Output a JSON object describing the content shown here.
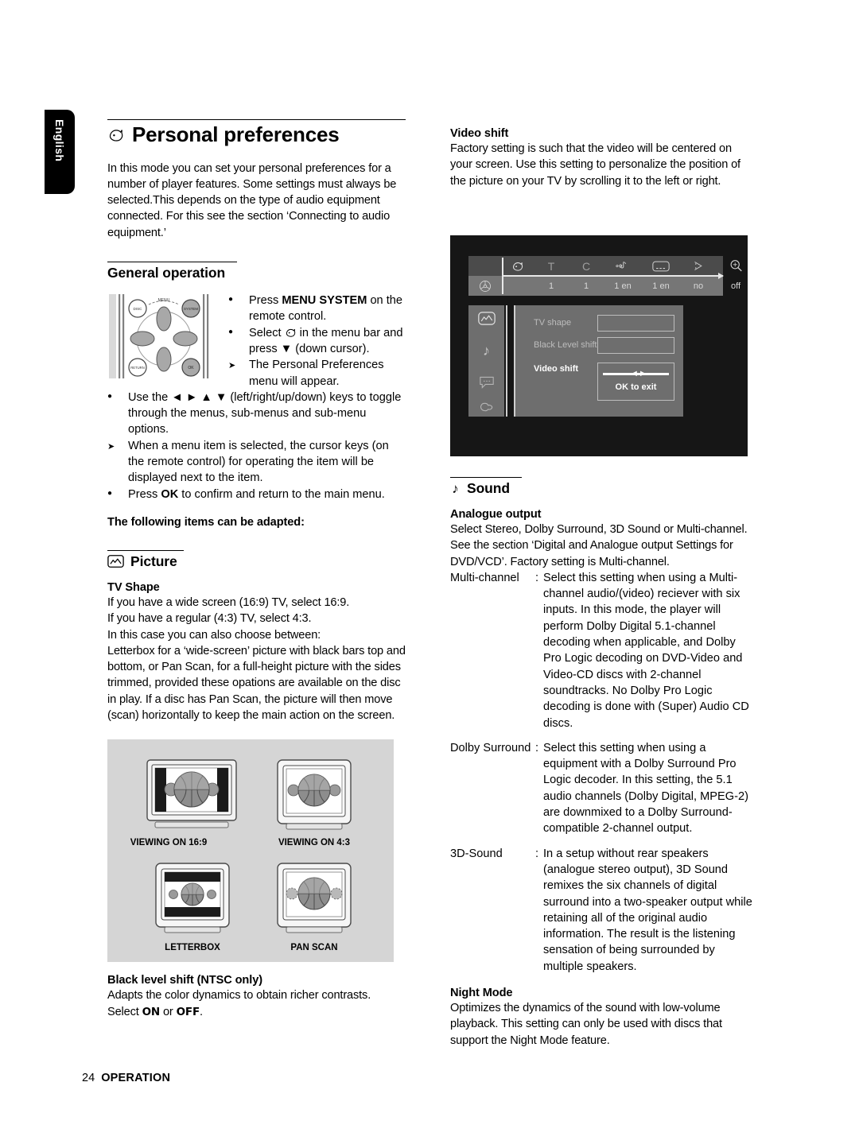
{
  "sidebar": {
    "language_tab": "English"
  },
  "left": {
    "title": "Personal preferences",
    "title_icon": "head-profile-icon",
    "intro": "In this mode you can set your personal preferences for a number of player features. Some settings must always be selected.This depends on the type of audio equipment connected. For this see the section ‘Connecting to audio equipment.’",
    "general_operation": {
      "heading": "General operation",
      "bullets": [
        {
          "marker": "dot",
          "text_pre": "Press ",
          "text_bold": "MENU SYSTEM",
          "text_post": " on the remote control."
        },
        {
          "marker": "dot",
          "text_pre": "Select ",
          "icon": "head-profile-icon",
          "text_post": " in the menu bar and press ▼ (down cursor)."
        },
        {
          "marker": "arrow",
          "text": "The Personal Preferences menu will appear."
        },
        {
          "marker": "dot",
          "text": "Use the ◄ ► ▲ ▼ (left/right/up/down) keys to toggle through the menus, sub-menus and sub-menu options."
        },
        {
          "marker": "arrow",
          "text": "When a menu item is selected, the cursor keys (on the remote control) for operating the item will be displayed next to the item."
        },
        {
          "marker": "dot",
          "text_pre": "Press ",
          "text_bold": "OK",
          "text_post": " to confirm and return to the main menu."
        }
      ],
      "following_items": "The following items can be adapted:"
    },
    "picture": {
      "heading": "Picture",
      "heading_icon": "picture-icon",
      "tv_shape_title": "TV Shape",
      "tv_shape_body": "If you have a wide screen (16:9) TV, select 16:9.\nIf you have a regular (4:3) TV, select 4:3.\nIn this case you can also choose between:\nLetterbox for a ‘wide-screen’ picture with black bars top and bottom, or Pan Scan, for a full-height picture with the sides trimmed, provided these opations are available on the disc in play. If a disc has Pan Scan, the picture will then move (scan) horizontally to keep the main action on the screen.",
      "figure_labels": [
        "VIEWING ON 16:9",
        "VIEWING ON 4:3",
        "LETTERBOX",
        "PAN SCAN"
      ],
      "black_level_title": "Black level shift (NTSC only)",
      "black_level_body_1": "Adapts the color dynamics to obtain richer contrasts.",
      "black_level_body_2_pre": "Select ",
      "black_level_on": "ON",
      "black_level_or": " or ",
      "black_level_off": "OFF",
      "black_level_body_2_post": "."
    }
  },
  "right": {
    "video_shift": {
      "title": "Video shift",
      "body": "Factory setting is such that the video will be centered on your screen. Use this setting to personalize the position of the picture on your TV by scrolling it to the left or right."
    },
    "osd": {
      "menubar_icons": [
        "personal-preferences-icon",
        "title-T-icon",
        "chapter-C-icon",
        "audio-language-icon",
        "subtitle-icon",
        "angle-icon",
        "zoom-icon"
      ],
      "menubar_disc_icon": "disc-icon",
      "menubar_values": [
        "1",
        "1",
        "1 en",
        "1 en",
        "no",
        "off"
      ],
      "side_icons": [
        "picture-icon",
        "sound-icon",
        "language-icon",
        "features-icon"
      ],
      "rows": [
        {
          "label": "TV shape",
          "active": false
        },
        {
          "label": "Black Level shift",
          "active": false
        },
        {
          "label": "Video shift",
          "active": true
        }
      ],
      "ok_to_exit": "OK to exit",
      "slider_handle": "◄►"
    },
    "sound": {
      "heading": "Sound",
      "heading_icon": "music-note-icon",
      "analogue_output_title": "Analogue output",
      "analogue_output_body": "Select Stereo, Dolby Surround, 3D Sound or Multi-channel. See the section ‘Digital and Analogue output Settings for DVD/VCD’. Factory setting is Multi-channel.",
      "definitions": [
        {
          "term": "Multi-channel",
          "def": "Select this setting when using a Multi-channel audio/(video) reciever with six inputs. In this mode, the player will perform Dolby Digital 5.1-channel decoding when applicable, and Dolby Pro Logic decoding on DVD-Video and Video-CD discs with 2-channel soundtracks. No Dolby Pro Logic decoding is done with (Super) Audio CD discs."
        },
        {
          "term": "Dolby Surround",
          "def": "Select this setting when using a equipment with a Dolby Surround Pro Logic decoder. In this setting, the 5.1 audio channels (Dolby Digital, MPEG-2) are downmixed to a Dolby Surround-compatible 2-channel output."
        },
        {
          "term": "3D-Sound",
          "def": "In a setup without rear speakers (analogue stereo output), 3D Sound remixes the six channels of digital surround into a two-speaker output while retaining all of the original audio information. The result is the listening sensation of being surrounded by multiple speakers."
        }
      ],
      "night_mode_title": "Night Mode",
      "night_mode_body": "Optimizes the dynamics of the sound with low-volume playback. This setting can only be used with discs that support the Night Mode feature."
    }
  },
  "footer": {
    "page_number": "24",
    "section": "OPERATION"
  }
}
